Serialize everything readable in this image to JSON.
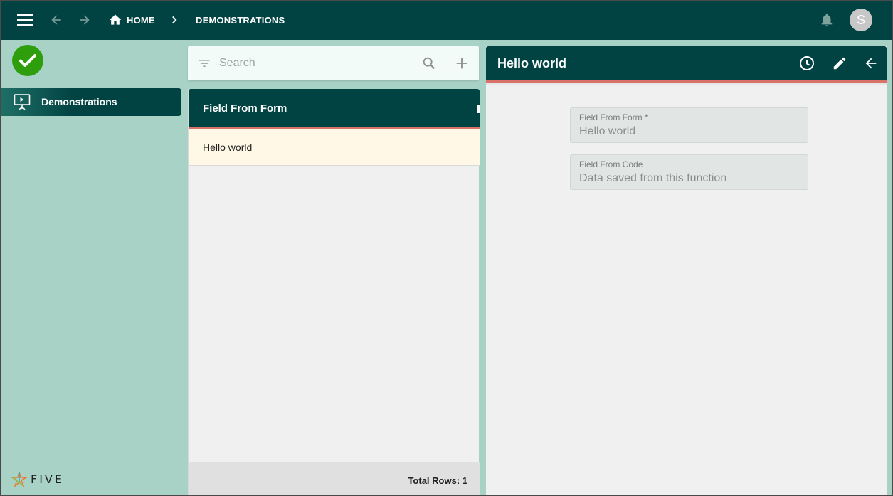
{
  "topbar": {
    "home_label": "HOME",
    "current_label": "DEMONSTRATIONS",
    "avatar_initial": "S"
  },
  "sidebar": {
    "items": [
      {
        "label": "Demonstrations",
        "icon": "presentation-icon"
      }
    ],
    "brand": "FIVE"
  },
  "list": {
    "search_placeholder": "Search",
    "column_header": "Field From Form",
    "rows": [
      "Hello world"
    ],
    "footer": "Total Rows: 1"
  },
  "detail": {
    "title": "Hello world",
    "fields": [
      {
        "label": "Field From Form *",
        "value": "Hello world"
      },
      {
        "label": "Field From Code",
        "value": "Data saved from this function"
      }
    ]
  },
  "colors": {
    "primary": "#014343",
    "accent_line": "#d9736a",
    "background": "#a9d2c6",
    "selected_row": "#fff8e6",
    "success": "#2e9e0d"
  }
}
